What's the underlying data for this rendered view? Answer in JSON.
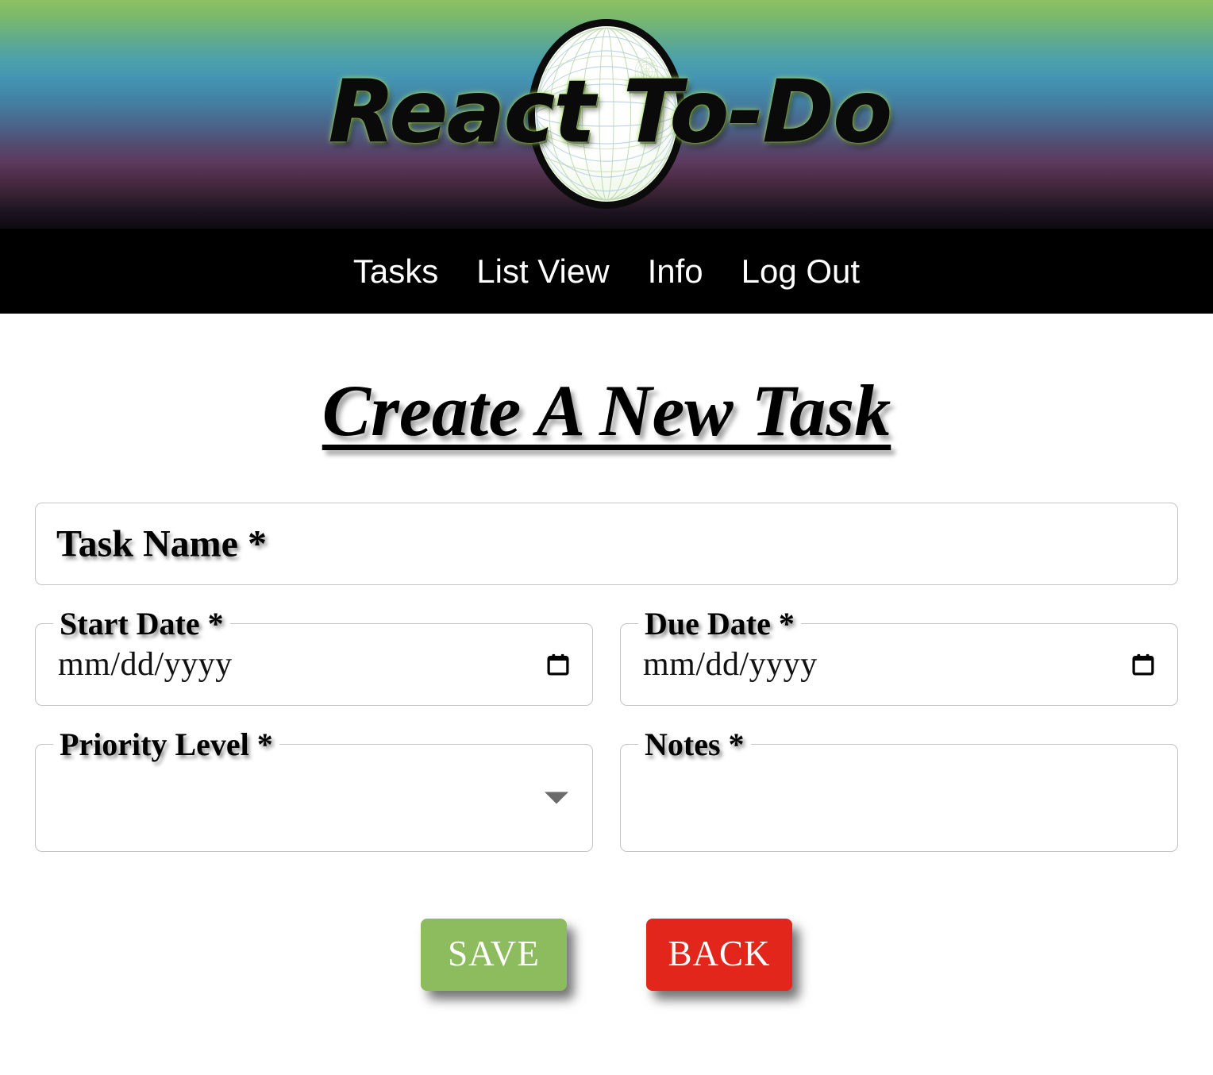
{
  "header": {
    "logo_text": "React To-Do",
    "logo_icon": "globe-wireframe-icon",
    "gradient": {
      "top": "#8cc162",
      "mid_teal": "#4495b3",
      "mid_purple": "#5b3a5e",
      "bottom": "#0d0a10"
    }
  },
  "nav": {
    "items": [
      {
        "label": "Tasks",
        "name": "nav-link-tasks"
      },
      {
        "label": "List View",
        "name": "nav-link-list-view"
      },
      {
        "label": "Info",
        "name": "nav-link-info"
      },
      {
        "label": "Log Out",
        "name": "nav-link-log-out"
      }
    ],
    "background": "#000000",
    "text_color": "#ffffff"
  },
  "main": {
    "title": "Create A New Task",
    "fields": {
      "task_name": {
        "label": "Task Name *",
        "value": "",
        "placeholder": ""
      },
      "start_date": {
        "label": "Start Date *",
        "value": "",
        "placeholder": "mm/dd/yyyy",
        "icon": "calendar-icon"
      },
      "due_date": {
        "label": "Due Date *",
        "value": "",
        "placeholder": "mm/dd/yyyy",
        "icon": "calendar-icon"
      },
      "priority_level": {
        "label": "Priority Level *",
        "value": "",
        "icon": "chevron-down-icon"
      },
      "notes": {
        "label": "Notes *",
        "value": "",
        "placeholder": ""
      }
    },
    "buttons": {
      "save": {
        "label": "SAVE",
        "color": "#8cbc5e"
      },
      "back": {
        "label": "BACK",
        "color": "#e3261c"
      }
    }
  }
}
